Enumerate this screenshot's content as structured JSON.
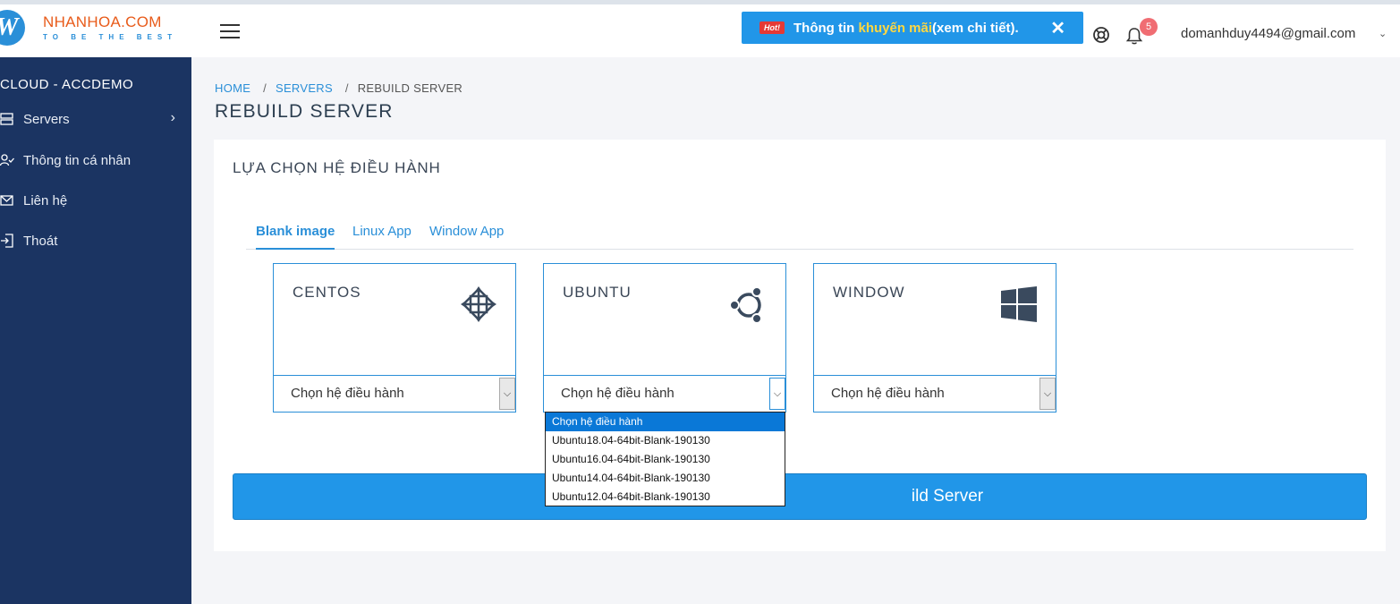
{
  "brand": {
    "logo_letter": "W",
    "name": "NHANHOA.COM",
    "tagline": "TO BE THE BEST"
  },
  "promo": {
    "badge": "Hot!",
    "text_prefix": "Thông tin ",
    "highlight": "khuyến mãi",
    "text_suffix": " (xem chi tiết).",
    "close": "✕"
  },
  "header": {
    "notification_count": "5",
    "user_email": "domanhduy4494@gmail.com",
    "user_caret": "⌄"
  },
  "sidebar": {
    "title": "CLOUD - ACCDEMO",
    "items": [
      {
        "label": "Servers",
        "icon": "server-icon",
        "chevron": "›"
      },
      {
        "label": "Thông tin cá nhân",
        "icon": "user-check-icon"
      },
      {
        "label": "Liên hệ",
        "icon": "mail-icon"
      },
      {
        "label": "Thoát",
        "icon": "logout-icon"
      }
    ]
  },
  "breadcrumb": {
    "home": "HOME",
    "sep": "/",
    "servers": "SERVERS",
    "current": "REBUILD SERVER"
  },
  "page_title": "REBUILD SERVER",
  "card": {
    "title": "LỰA CHỌN HỆ ĐIỀU HÀNH",
    "tabs": [
      "Blank image",
      "Linux App",
      "Window App"
    ],
    "os_options": [
      {
        "name": "CENTOS",
        "icon": "centos-icon",
        "select_value": "Chọn hệ điều hành"
      },
      {
        "name": "UBUNTU",
        "icon": "ubuntu-icon",
        "select_value": "Chọn hệ điều hành"
      },
      {
        "name": "WINDOW",
        "icon": "windows-icon",
        "select_value": "Chọn hệ điều hành"
      }
    ],
    "rebuild_button_visible": "ild Server"
  },
  "dropdown": {
    "options": [
      "Chọn hệ điều hành",
      "Ubuntu18.04-64bit-Blank-190130",
      "Ubuntu16.04-64bit-Blank-190130",
      "Ubuntu14.04-64bit-Blank-190130",
      "Ubuntu12.04-64bit-Blank-190130"
    ],
    "selected_index": 0
  },
  "colors": {
    "sidebar_bg": "#1b3462",
    "accent": "#2196e8",
    "brand_orange": "#e85b1a",
    "promo_highlight": "#ffd740",
    "badge": "#f06d73"
  }
}
